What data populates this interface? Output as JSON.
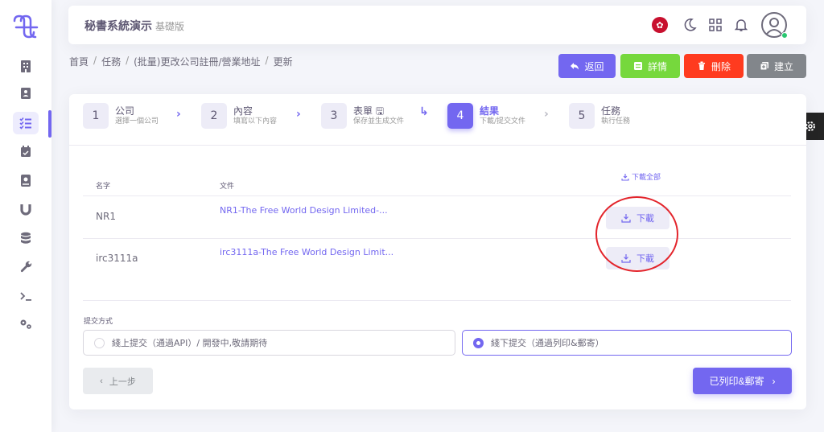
{
  "header": {
    "title": "秘書系統演示",
    "edition": "基礎版"
  },
  "breadcrumb": [
    "首頁",
    "任務",
    "(批量)更改公司註冊/營業地址",
    "更新"
  ],
  "actions": {
    "back": "返回",
    "details": "詳情",
    "delete": "刪除",
    "create": "建立"
  },
  "steps": [
    {
      "num": "1",
      "title": "公司",
      "sub": "選擇一個公司"
    },
    {
      "num": "2",
      "title": "內容",
      "sub": "填寫以下內容"
    },
    {
      "num": "3",
      "title": "表單",
      "sub": "保存並生成文件"
    },
    {
      "num": "4",
      "title": "結果",
      "sub": "下載/提交文件"
    },
    {
      "num": "5",
      "title": "任務",
      "sub": "執行任務"
    }
  ],
  "table": {
    "col_name": "名字",
    "col_file": "文件",
    "download_all": "下載全部",
    "rows": [
      {
        "name": "NR1",
        "file": "NR1-The Free World Design Limited-...",
        "action": "下載"
      },
      {
        "name": "irc3111a",
        "file": "irc3111a-The Free World Design Limit...",
        "action": "下載"
      }
    ]
  },
  "submission": {
    "label": "提交方式",
    "online": "綫上提交（通過API）/ 開發中,敬請期待",
    "offline": "綫下提交（通過列印&郵寄）",
    "selected": "offline"
  },
  "nav": {
    "prev": "上一步",
    "next": "已列印&郵寄"
  },
  "colors": {
    "primary": "#7367f0",
    "success": "#76d83d",
    "danger": "#ff3b1f",
    "secondary": "#82868b"
  }
}
